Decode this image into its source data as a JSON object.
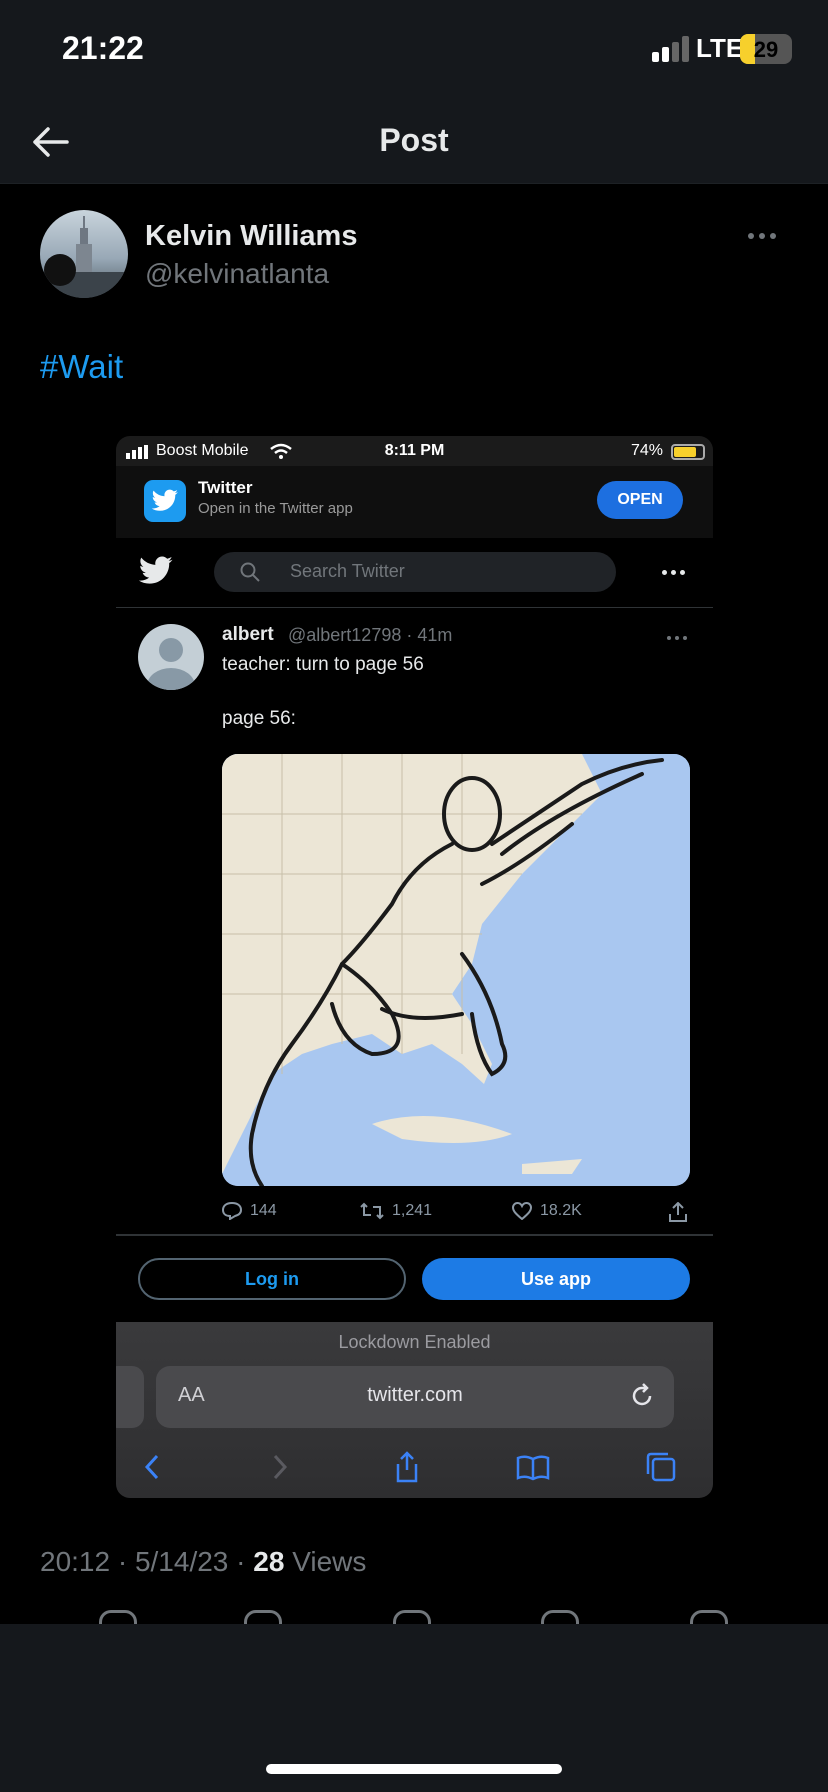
{
  "status_bar": {
    "time": "21:22",
    "network": "LTE",
    "battery": "29",
    "battery_level_pct": 29
  },
  "header": {
    "title": "Post"
  },
  "post": {
    "author_name": "Kelvin Williams",
    "author_handle": "@kelvinatlanta",
    "text": "#Wait",
    "timestamp": "20:12 · 5/14/23 · ",
    "views_count": "28",
    "views_label": " Views"
  },
  "embedded_screenshot": {
    "status": {
      "carrier": "Boost Mobile",
      "time": "8:11 PM",
      "battery": "74%"
    },
    "banner": {
      "app_name": "Twitter",
      "subtitle": "Open in the Twitter app",
      "open_label": "OPEN"
    },
    "search_placeholder": "Search Twitter",
    "tweet": {
      "name": "albert",
      "handle_time": "@albert12798 · 41m",
      "line1": "teacher: turn to page 56",
      "line2": "page 56:",
      "replies": "144",
      "retweets": "1,241",
      "likes": "18.2K"
    },
    "login_label": "Log in",
    "use_app_label": "Use app",
    "lockdown_label": "Lockdown Enabled",
    "url_aa": "AA",
    "url": "twitter.com"
  },
  "colors": {
    "accent": "#1d9bf0",
    "background": "#000000",
    "muted": "#71767b"
  }
}
